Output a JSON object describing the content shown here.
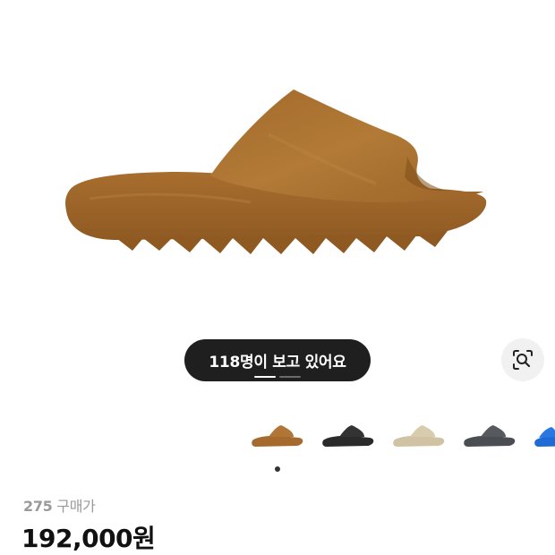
{
  "product": {
    "image_icon": "slide-sandal-image",
    "color_name_accent": "#a06a2a"
  },
  "viewers": {
    "text": "118명이 보고 있어요"
  },
  "lens": {
    "icon": "image-search-icon"
  },
  "variants": [
    {
      "icon": "slide-ochre-thumb",
      "color": "#a56b2e"
    },
    {
      "icon": "slide-black-thumb",
      "color": "#2a2a2a"
    },
    {
      "icon": "slide-bone-thumb",
      "color": "#cfc3a4"
    },
    {
      "icon": "slide-grey-thumb",
      "color": "#4a4e52"
    },
    {
      "icon": "slide-blue-thumb",
      "color": "#1e6ad6"
    }
  ],
  "pricing": {
    "size": "275",
    "size_suffix": "구매가",
    "price": "192,000원"
  }
}
